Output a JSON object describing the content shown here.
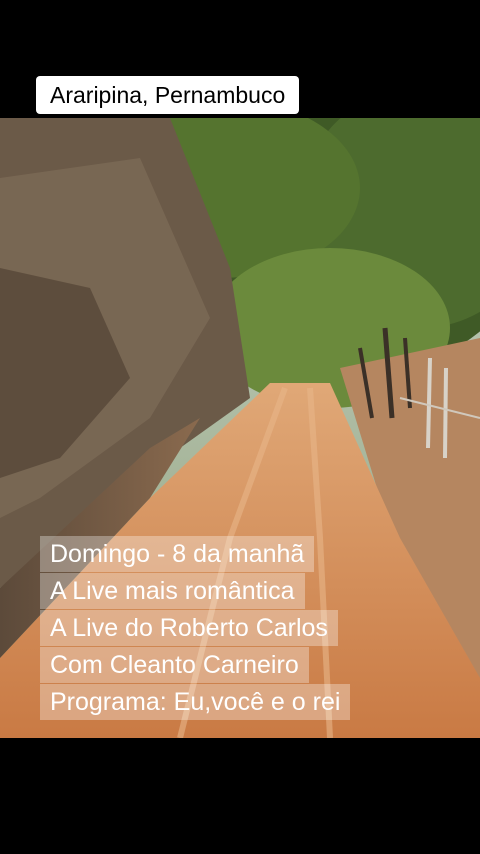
{
  "location": "Araripina, Pernambuco",
  "caption_lines": [
    "Domingo - 8 da manhã",
    "A Live mais romântica",
    "A Live do Roberto Carlos",
    "Com Cleanto Carneiro",
    "Programa: Eu,você e o rei"
  ],
  "colors": {
    "background": "#000000",
    "road": "#d9905a",
    "foliage": "#4d6b2e",
    "dry_brush": "#6b5a48"
  }
}
